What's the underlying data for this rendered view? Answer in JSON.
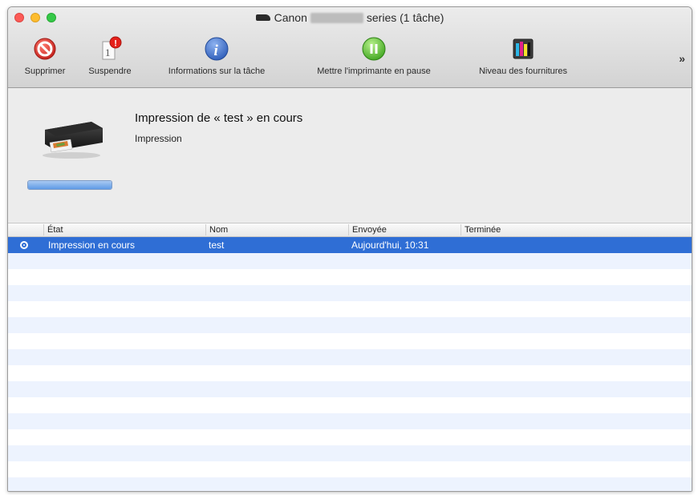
{
  "window": {
    "title_prefix": "Canon",
    "title_suffix": "series (1 tâche)"
  },
  "toolbar": {
    "items": [
      {
        "label": "Supprimer",
        "icon": "delete-icon"
      },
      {
        "label": "Suspendre",
        "icon": "suspend-icon"
      },
      {
        "label": "Informations sur la tâche",
        "icon": "info-icon"
      },
      {
        "label": "Mettre l'imprimante en pause",
        "icon": "pause-icon"
      },
      {
        "label": "Niveau des fournitures",
        "icon": "supply-level-icon"
      }
    ],
    "overflow": "»"
  },
  "job": {
    "title": "Impression de « test » en cours",
    "status": "Impression",
    "progress": 1.0
  },
  "table": {
    "columns": [
      "État",
      "Nom",
      "Envoyée",
      "Terminée"
    ],
    "rows": [
      {
        "etat": "Impression en cours",
        "nom": "test",
        "envoyee": "Aujourd'hui, 10:31",
        "terminee": ""
      }
    ]
  },
  "colors": {
    "selection": "#2f6ed5",
    "delete": "#d8322c",
    "info": "#3d6fcf",
    "pause": "#4cb82a"
  }
}
